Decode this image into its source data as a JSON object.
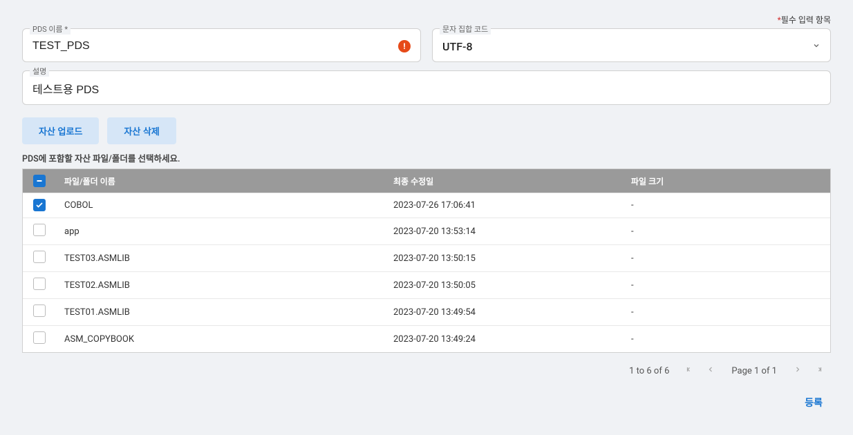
{
  "required_label": "필수 입력 항목",
  "form": {
    "pds_name": {
      "label": "PDS 이름 *",
      "value": "TEST_PDS"
    },
    "charset": {
      "label": "문자 집합 코드",
      "value": "UTF-8"
    },
    "description": {
      "label": "설명",
      "value": "테스트용 PDS"
    }
  },
  "buttons": {
    "upload": "자산 업로드",
    "delete": "자산 삭제",
    "submit": "등록"
  },
  "helper": "PDS에 포함할 자산 파일/폴더를 선택하세요.",
  "table": {
    "columns": {
      "name": "파일/폴더 이름",
      "date": "최종 수정일",
      "size": "파일 크기"
    },
    "rows": [
      {
        "checked": true,
        "name": "COBOL",
        "date": "2023-07-26 17:06:41",
        "size": "-"
      },
      {
        "checked": false,
        "name": "app",
        "date": "2023-07-20 13:53:14",
        "size": "-"
      },
      {
        "checked": false,
        "name": "TEST03.ASMLIB",
        "date": "2023-07-20 13:50:15",
        "size": "-"
      },
      {
        "checked": false,
        "name": "TEST02.ASMLIB",
        "date": "2023-07-20 13:50:05",
        "size": "-"
      },
      {
        "checked": false,
        "name": "TEST01.ASMLIB",
        "date": "2023-07-20 13:49:54",
        "size": "-"
      },
      {
        "checked": false,
        "name": "ASM_COPYBOOK",
        "date": "2023-07-20 13:49:24",
        "size": "-"
      }
    ]
  },
  "pagination": {
    "range": "1 to 6 of 6",
    "page": "Page 1 of 1"
  }
}
